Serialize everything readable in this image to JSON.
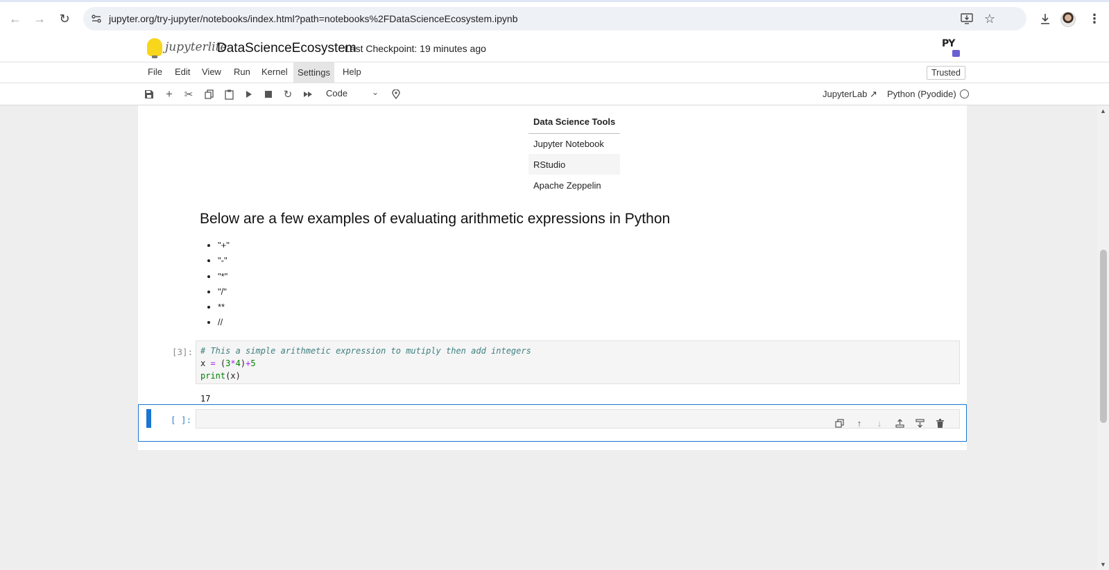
{
  "browser": {
    "url": "jupyter.org/try-jupyter/notebooks/index.html?path=notebooks%2FDataScienceEcosystem.ipynb"
  },
  "header": {
    "logo_text": "jupyterlite",
    "notebook_title": "DataScienceEcosystem",
    "checkpoint": "Last Checkpoint: 19 minutes ago",
    "kernel_logo_text": "PY"
  },
  "menu": {
    "items": [
      "File",
      "Edit",
      "View",
      "Run",
      "Kernel",
      "Settings",
      "Help"
    ],
    "trusted": "Trusted"
  },
  "toolbar": {
    "cell_type": "Code",
    "jupyterlab_link": "JupyterLab",
    "kernel_name": "Python (Pyodide)"
  },
  "notebook": {
    "table": {
      "header": "Data Science Tools",
      "rows": [
        "Jupyter Notebook",
        "RStudio",
        "Apache Zeppelin"
      ]
    },
    "heading": "Below are a few examples of evaluating arithmetic expressions in Python",
    "list_items": [
      "\"+\"",
      "\"-\"",
      "\"*\"",
      "\"/\"",
      "**",
      "//"
    ],
    "code_cell": {
      "prompt": "[3]:",
      "comment": "# This a simple arithmetic expression to mutiply then add integers",
      "output": "17"
    },
    "empty_cell": {
      "prompt": "[ ]:"
    }
  }
}
